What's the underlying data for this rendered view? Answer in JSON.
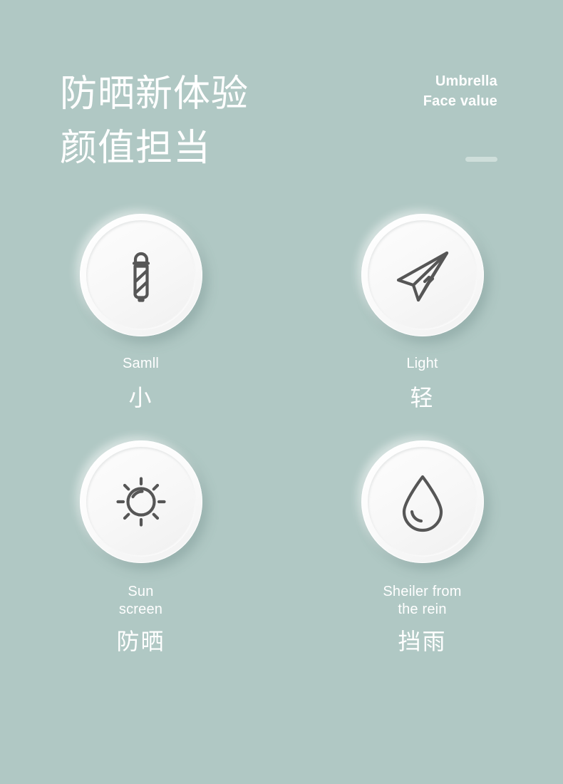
{
  "page": {
    "background_color": "#b0c8c4",
    "text_color": "#ffffff",
    "icon_stroke_color": "#565656",
    "badge_color": "#fafafa"
  },
  "header": {
    "headline_line1": "防晒新体验",
    "headline_line2": "颜值担当",
    "eyebrow_line1": "Umbrella",
    "eyebrow_line2": "Face value",
    "rule_color": "#cededa"
  },
  "features": [
    {
      "icon": "folded-umbrella-icon",
      "label_en": "Samll",
      "label_cn": "小"
    },
    {
      "icon": "paper-plane-icon",
      "label_en": "Light",
      "label_cn": "轻"
    },
    {
      "icon": "sun-icon",
      "label_en": "Sun\nscreen",
      "label_cn": "防晒"
    },
    {
      "icon": "water-drop-icon",
      "label_en": "Sheiler from\nthe rein",
      "label_cn": "挡雨"
    }
  ]
}
